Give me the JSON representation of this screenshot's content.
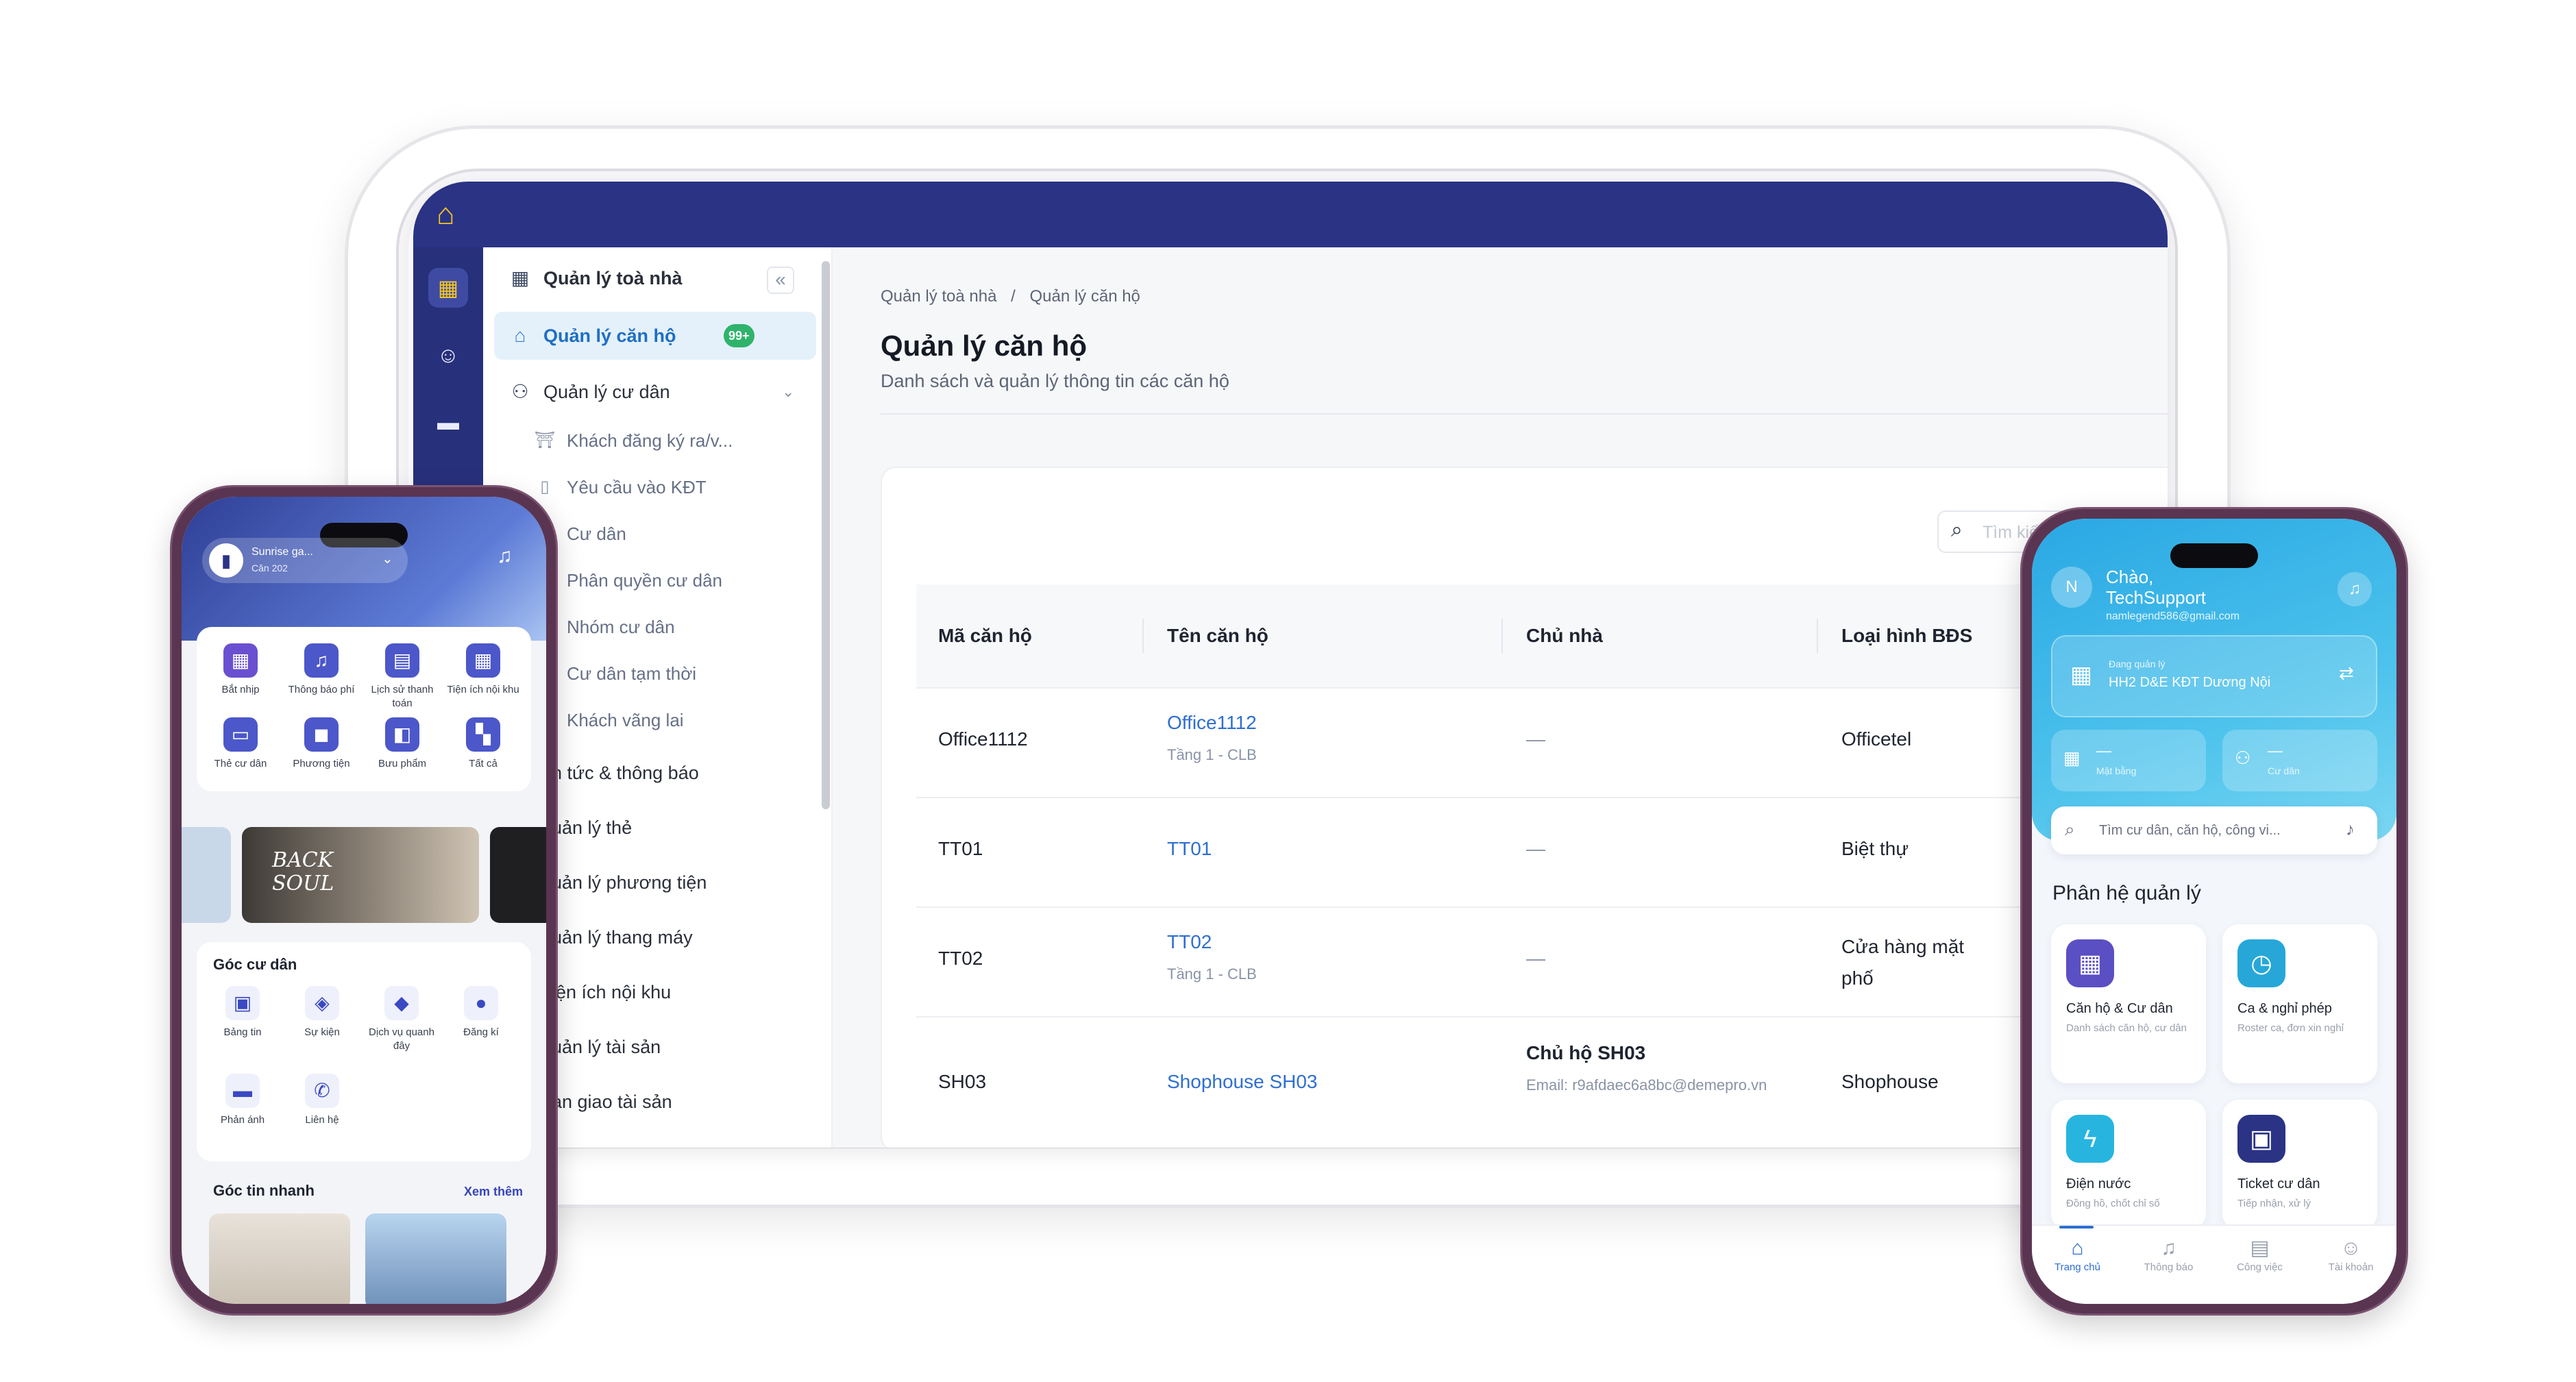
{
  "desktop": {
    "logo_icon": "building-logo-icon",
    "rail_icons": [
      "buildings-icon",
      "person-icon",
      "chat-icon",
      "card-icon"
    ],
    "sidebar": {
      "group_title": "Quản lý toà nhà",
      "collapse_icon": "«",
      "active_item": "Quản lý căn hộ",
      "badge": "99+",
      "residents_group": "Quản lý cư dân",
      "sub_items": [
        "Khách đăng ký ra/v...",
        "Yêu cầu vào KĐT",
        "Cư dân",
        "Phân quyền cư dân",
        "Nhóm cư dân",
        "Cư dân tạm thời",
        "Khách vãng lai"
      ],
      "truncated_items": [
        "n tức & thông báo",
        "uản lý thẻ",
        "uản lý phương tiện",
        "uản lý thang máy",
        "iện ích nội khu",
        "uản lý tài sản",
        "àn giao tài sản"
      ]
    },
    "breadcrumb": {
      "parent": "Quản lý toà nhà",
      "separator": "/",
      "current": "Quản lý căn hộ"
    },
    "page_title": "Quản lý căn hộ",
    "page_subtitle": "Danh sách và quản lý thông tin các căn hộ",
    "search_placeholder": "Tìm kiếm",
    "table": {
      "headers": [
        "Mã căn hộ",
        "Tên căn hộ",
        "Chủ nhà",
        "Loại hình BĐS"
      ],
      "rows": [
        {
          "code": "Office1112",
          "name": "Office1112",
          "sub": "Tầng 1 - CLB",
          "owner": "—",
          "owner_email": "",
          "type": "Officetel"
        },
        {
          "code": "TT01",
          "name": "TT01",
          "sub": "",
          "owner": "—",
          "owner_email": "",
          "type": "Biệt thự"
        },
        {
          "code": "TT02",
          "name": "TT02",
          "sub": "Tầng 1 - CLB",
          "owner": "—",
          "owner_email": "",
          "type": "Cửa hàng mặt phố"
        },
        {
          "code": "SH03",
          "name": "Shophouse SH03",
          "sub": "",
          "owner": "Chủ hộ SH03",
          "owner_email": "Email: r9afdaec6a8bc@demepro.vn",
          "type": "Shophouse"
        }
      ]
    }
  },
  "phone_left": {
    "project": "Sunrise ga...",
    "unit": "Căn 202",
    "quick_tiles": [
      {
        "label": "Bắt nhịp",
        "icon": "calendar-icon",
        "color": "#6a4fd0"
      },
      {
        "label": "Thông báo phí",
        "icon": "bell-icon",
        "color": "#4c57c9"
      },
      {
        "label": "Lịch sử thanh toán",
        "icon": "receipt-icon",
        "color": "#4c57c9"
      },
      {
        "label": "Tiện ích nội khu",
        "icon": "grid-icon",
        "color": "#4c57c9"
      },
      {
        "label": "Thẻ cư dân",
        "icon": "id-card-icon",
        "color": "#4c57c9"
      },
      {
        "label": "Phương tiện",
        "icon": "car-icon",
        "color": "#4c57c9"
      },
      {
        "label": "Bưu phẩm",
        "icon": "package-icon",
        "color": "#4c57c9"
      },
      {
        "label": "Tất cả",
        "icon": "apps-icon",
        "color": "#4c57c9"
      }
    ],
    "banner_text": "BACK SOUL",
    "resident_section": "Góc cư dân",
    "resident_tiles": [
      {
        "label": "Bảng tin",
        "icon": "board-icon"
      },
      {
        "label": "Sự kiện",
        "icon": "event-icon"
      },
      {
        "label": "Dịch vụ quanh đây",
        "icon": "map-icon"
      },
      {
        "label": "Đăng kí",
        "icon": "register-icon"
      },
      {
        "label": "Phản ánh",
        "icon": "feedback-icon"
      },
      {
        "label": "Liên hệ",
        "icon": "phone-icon"
      }
    ],
    "news_section": "Góc tin nhanh",
    "see_more": "Xem thêm"
  },
  "phone_right": {
    "avatar_letter": "N",
    "greeting": "Chào, ",
    "user_name": "TechSupport",
    "email": "namlegend586@gmail.com",
    "managing_label": "Đang quản lý",
    "managing_value": "HH2 D&E KĐT Dương Nội",
    "stat1_value": "—",
    "stat1_label": "Mặt bằng",
    "stat2_value": "—",
    "stat2_label": "Cư dân",
    "search_placeholder": "Tìm cư dân, căn hộ, công vi...",
    "section_title": "Phân hệ quản lý",
    "modules": [
      {
        "title": "Căn hộ & Cư dân",
        "sub": "Danh sách căn hộ, cư dân",
        "color": "#5b4fc4",
        "icon": "building-icon"
      },
      {
        "title": "Ca & nghỉ phép",
        "sub": "Roster ca, đơn xin nghỉ",
        "color": "#27a7d8",
        "icon": "clock-icon"
      },
      {
        "title": "Điện nước",
        "sub": "Đồng hồ, chốt chỉ số",
        "color": "#27b5e0",
        "icon": "bolt-icon"
      },
      {
        "title": "Ticket cư dân",
        "sub": "Tiếp nhận, xử lý",
        "color": "#2b3385",
        "icon": "ticket-icon"
      }
    ],
    "nav": [
      "Trang chủ",
      "Thông báo",
      "Công việc",
      "Tài khoản"
    ]
  }
}
